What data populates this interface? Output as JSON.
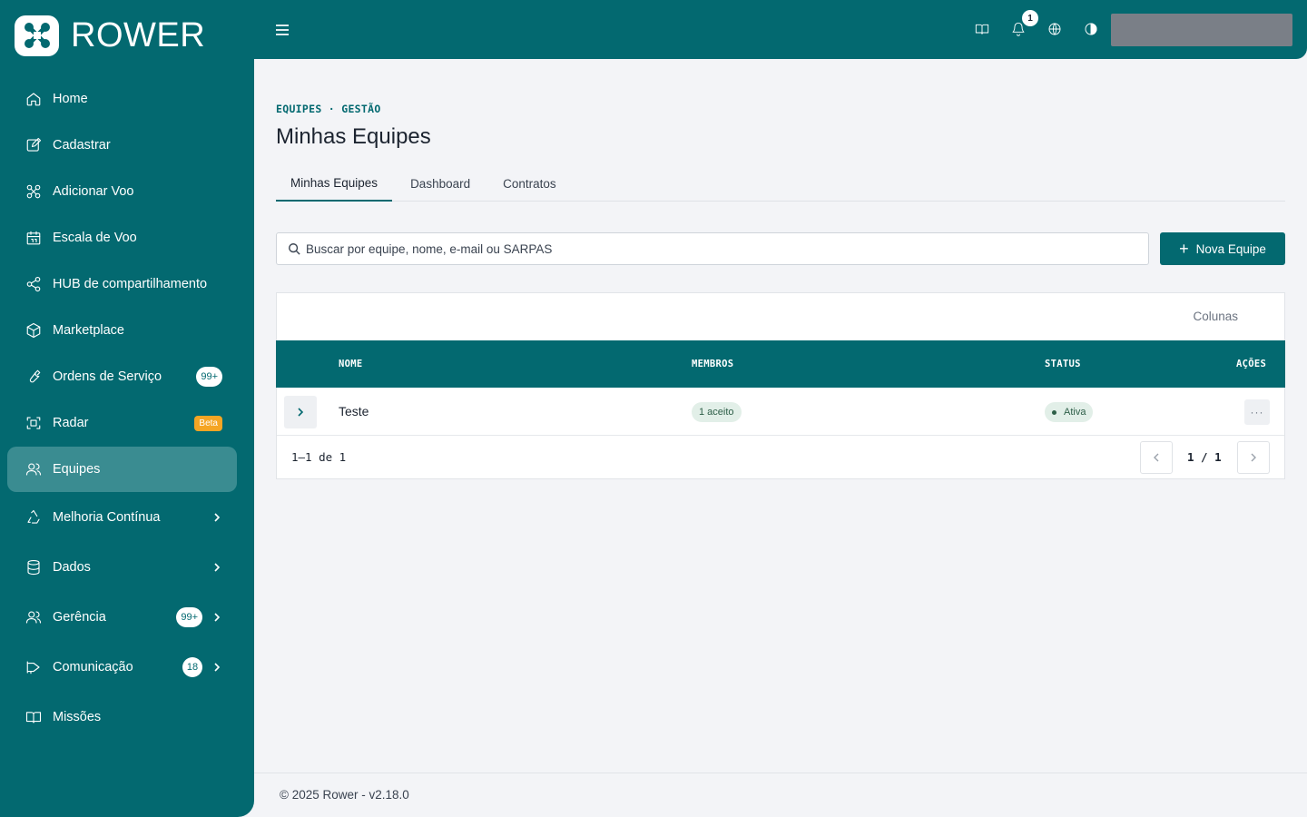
{
  "brand": {
    "name": "ROWER",
    "icon": "drone-logo-icon"
  },
  "sidebar": {
    "items": [
      {
        "label": "Home",
        "icon": "home-icon"
      },
      {
        "label": "Cadastrar",
        "icon": "edit-icon"
      },
      {
        "label": "Adicionar Voo",
        "icon": "drone-icon"
      },
      {
        "label": "Escala de Voo",
        "icon": "calendar-icon"
      },
      {
        "label": "HUB de compartilhamento",
        "icon": "share-icon"
      },
      {
        "label": "Marketplace",
        "icon": "box-icon"
      },
      {
        "label": "Ordens de Serviço",
        "icon": "wrench-icon",
        "badge": "99+"
      },
      {
        "label": "Radar",
        "icon": "radar-icon",
        "badge": "Beta"
      },
      {
        "label": "Equipes",
        "icon": "users-icon",
        "active": true
      },
      {
        "label": "Melhoria Contínua",
        "icon": "recycle-icon"
      },
      {
        "label": "Dados",
        "icon": "database-icon"
      },
      {
        "label": "Gerência",
        "icon": "users-icon",
        "badge": "99+"
      },
      {
        "label": "Comunicação",
        "icon": "megaphone-icon",
        "badge": "18"
      },
      {
        "label": "Missões",
        "icon": "book-icon"
      }
    ]
  },
  "topbar": {
    "notifications_count": "1",
    "icons": [
      "book-icon",
      "bell-icon",
      "globe-icon",
      "contrast-icon"
    ]
  },
  "page": {
    "breadcrumb": "EQUIPES · GESTÃO",
    "title": "Minhas Equipes",
    "tabs": [
      "Minhas Equipes",
      "Dashboard",
      "Contratos"
    ],
    "search_placeholder": "Buscar por equipe, nome, e-mail ou SARPAS",
    "new_button": "Nova Equipe"
  },
  "table": {
    "columns_button": "Colunas",
    "headers": {
      "name": "NOME",
      "members": "MEMBROS",
      "status": "STATUS",
      "actions": "AÇÕES"
    },
    "rows": [
      {
        "name": "Teste",
        "members": "1 aceito",
        "status": "Ativa"
      }
    ],
    "range": "1–1 de 1",
    "page": "1 / 1"
  },
  "footer": {
    "text": "© 2025 Rower - v2.18.0"
  },
  "colors": {
    "primary": "#036970",
    "active_item": "#3a8c91",
    "beta": "#f5a524"
  }
}
